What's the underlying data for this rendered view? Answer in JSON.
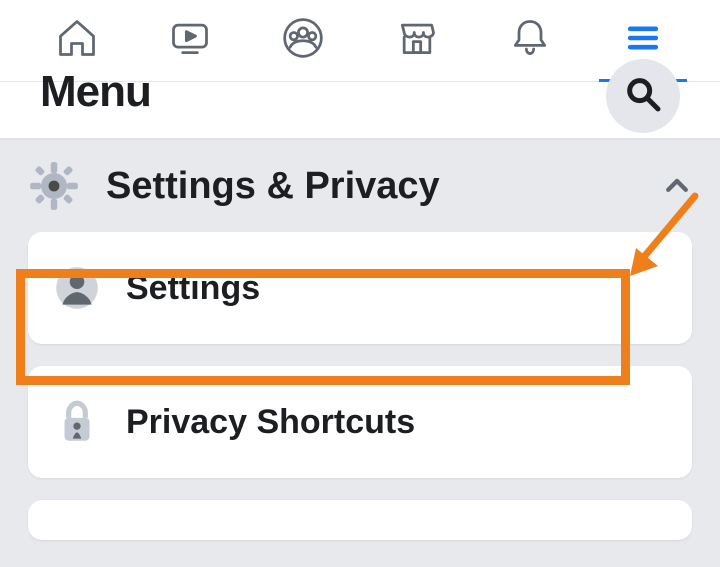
{
  "tabs": {
    "home": "home",
    "video": "video",
    "groups": "groups",
    "marketplace": "marketplace",
    "notifications": "notifications",
    "menu": "menu"
  },
  "page_title": "Menu",
  "section": {
    "title": "Settings & Privacy",
    "items": [
      {
        "label": "Settings"
      },
      {
        "label": "Privacy Shortcuts"
      }
    ]
  },
  "annotation": {
    "highlight_target": "settings-card",
    "arrow_color": "#ef7f1a"
  }
}
